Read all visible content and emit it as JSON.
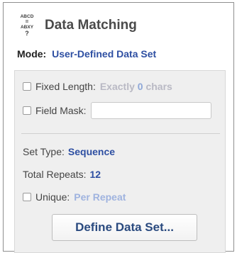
{
  "header": {
    "title": "Data Matching",
    "icon": "abcd-abxy-match-icon",
    "icon_text": [
      "ABCD",
      "=",
      "ABXY",
      "?"
    ]
  },
  "mode": {
    "label": "Mode:",
    "value": "User-Defined Data Set"
  },
  "fixed_length": {
    "label": "Fixed Length:",
    "value_prefix": "Exactly",
    "value_number": "0",
    "value_suffix": "chars",
    "checked": false
  },
  "field_mask": {
    "label": "Field Mask:",
    "value": "",
    "checked": false
  },
  "set_type": {
    "label": "Set Type:",
    "value": "Sequence"
  },
  "total_repeats": {
    "label": "Total Repeats:",
    "value": "12"
  },
  "unique": {
    "label": "Unique:",
    "value": "Per Repeat",
    "checked": false
  },
  "define_button": {
    "label": "Define Data Set..."
  },
  "colors": {
    "accent": "#2e4fa2",
    "muted": "#9fb3df",
    "panel_bg": "#efefef"
  }
}
